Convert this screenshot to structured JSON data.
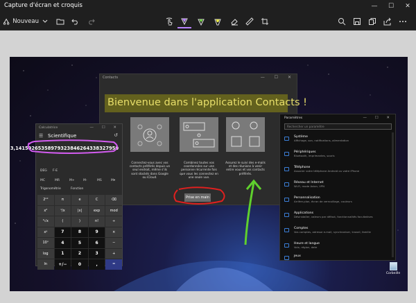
{
  "app": {
    "title": "Capture d'écran et croquis",
    "window_controls": [
      "—",
      "☐",
      "✕"
    ]
  },
  "toolbar": {
    "new_label": "Nouveau",
    "icons": [
      "snip-icon",
      "chevron-down-icon",
      "folder-icon",
      "undo-icon",
      "redo-icon",
      "touch-writing-icon",
      "ballpoint-pen-icon",
      "pencil-icon",
      "highlighter-icon",
      "eraser-icon",
      "ruler-icon",
      "crop-icon",
      "zoom-icon",
      "save-icon",
      "copy-icon",
      "share-icon",
      "more-icon"
    ],
    "pen_colors": {
      "ballpoint": "#b983ff",
      "pencil": "#7bd94b",
      "highlighter": "#e8e84a"
    }
  },
  "contacts_window": {
    "title": "Contacts",
    "controls": "— ☐ ✕",
    "welcome": "Bienvenue dans l'application Contacts !",
    "cards": [
      {
        "text": "Connectez-vous avec vos contacts préférés depuis un seul endroit, même s'ils sont stockés dans Google ou iCloud."
      },
      {
        "text": "Combinez toutes vos coordonnées sur une personne récurrente fois que vous les connectez en une seule vue."
      },
      {
        "text": "Assurez le suivi des e-mails et des réunions à venir entre vous et vos contacts préférés."
      }
    ],
    "start_button": "Prise en main"
  },
  "calculator": {
    "title": "Calculatrice",
    "controls": "— ☐ ✕",
    "mode": "Scientifique",
    "display": "3,14159265358979323846264338327950",
    "deg": "DEG",
    "fe": "F-E",
    "memory": [
      "MC",
      "MR",
      "M+",
      "M-",
      "MS",
      "M▾"
    ],
    "trig_label": "Trigonométrie",
    "func_label": "Fonction",
    "keys": [
      "2ⁿᵈ",
      "π",
      "e",
      "C",
      "⌫",
      "x²",
      "¹/x",
      "|x|",
      "exp",
      "mod",
      "²√x",
      "(",
      ")",
      "n!",
      "÷",
      "xʸ",
      "7",
      "8",
      "9",
      "×",
      "10ˣ",
      "4",
      "5",
      "6",
      "−",
      "log",
      "1",
      "2",
      "3",
      "+",
      "ln",
      "+/−",
      "0",
      ",",
      "="
    ]
  },
  "settings_window": {
    "title": "Paramètres",
    "controls": "— ☐ ✕",
    "search_placeholder": "Rechercher un paramètre",
    "items": [
      {
        "name": "Système",
        "desc": "Affichage, son, notifications, alimentation"
      },
      {
        "name": "Périphériques",
        "desc": "Bluetooth, imprimantes, souris"
      },
      {
        "name": "Téléphone",
        "desc": "Associer votre téléphone Android ou votre iPhone"
      },
      {
        "name": "Réseau et Internet",
        "desc": "Wi-Fi, mode Avion, VPN"
      },
      {
        "name": "Personnalisation",
        "desc": "Arrière-plan, écran de verrouillage, couleurs"
      },
      {
        "name": "Applications",
        "desc": "Désinstaller, valeurs par défaut, fonctionnalités facultatives"
      },
      {
        "name": "Comptes",
        "desc": "Vos comptes, adresse e-mail, synchroniser, travail, famille"
      },
      {
        "name": "Heure et langue",
        "desc": "Voix, région, date"
      },
      {
        "name": "Jeux",
        "desc": ""
      }
    ]
  },
  "desktop": {
    "recycle_bin_label": "Corbeille"
  },
  "annotations": {
    "highlighter_color": "#e8e84a",
    "purple_ink": "#d35cf0",
    "red_ink": "#e0201f",
    "green_ink": "#5fd02d"
  }
}
